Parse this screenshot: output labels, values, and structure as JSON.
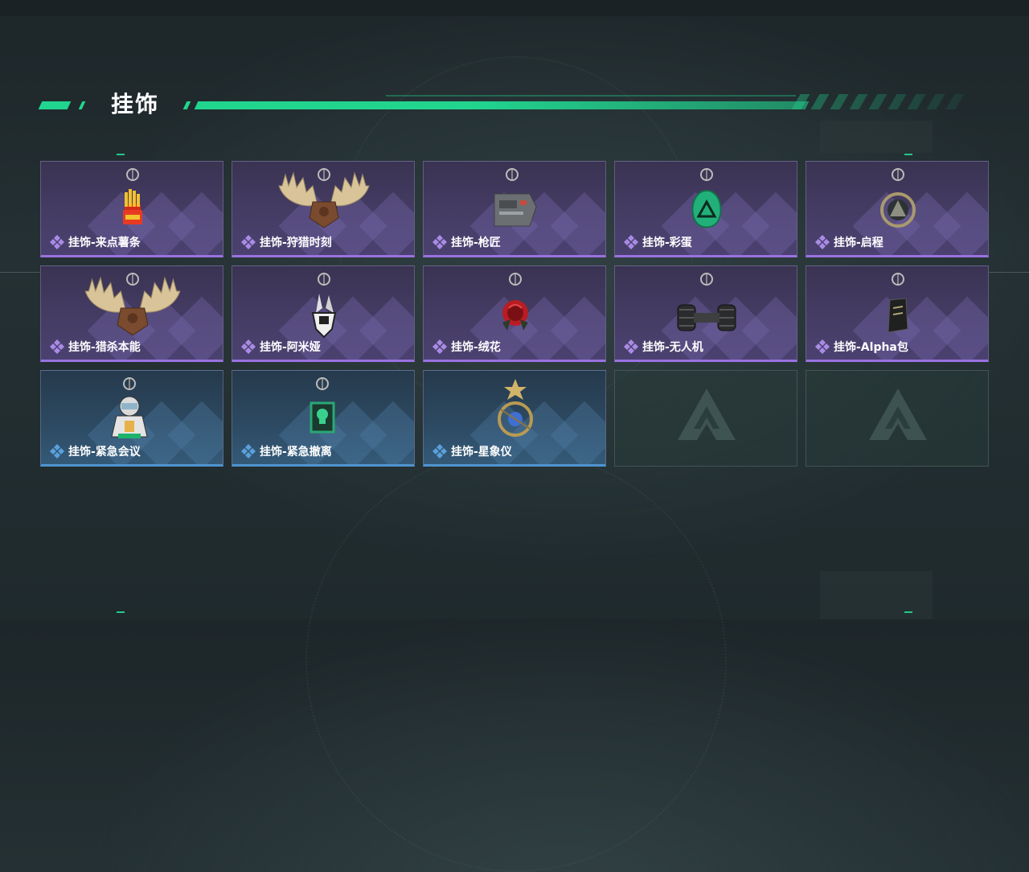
{
  "section": {
    "title": "挂饰"
  },
  "colors": {
    "accent": "#21d58f",
    "purple_rarity": "#9a72e0",
    "blue_rarity": "#4f94cf"
  },
  "items": [
    {
      "label": "挂饰-来点薯条",
      "rarity": "purple",
      "icon": "fries-charm-icon"
    },
    {
      "label": "挂饰-狩猎时刻",
      "rarity": "purple",
      "icon": "moose-antler-charm-icon"
    },
    {
      "label": "挂饰-枪匠",
      "rarity": "purple",
      "icon": "gunsmith-charm-icon"
    },
    {
      "label": "挂饰-彩蛋",
      "rarity": "purple",
      "icon": "easter-egg-charm-icon"
    },
    {
      "label": "挂饰-启程",
      "rarity": "purple",
      "icon": "compass-charm-icon"
    },
    {
      "label": "挂饰-猎杀本能",
      "rarity": "purple",
      "icon": "moose-trophy-charm-icon"
    },
    {
      "label": "挂饰-阿米娅",
      "rarity": "purple",
      "icon": "rabbit-charm-icon"
    },
    {
      "label": "挂饰-绒花",
      "rarity": "purple",
      "icon": "rose-charm-icon"
    },
    {
      "label": "挂饰-无人机",
      "rarity": "purple",
      "icon": "drone-charm-icon"
    },
    {
      "label": "挂饰-Alpha包",
      "rarity": "purple",
      "icon": "alpha-pack-charm-icon"
    },
    {
      "label": "挂饰-紧急会议",
      "rarity": "blue",
      "icon": "astronaut-charm-icon"
    },
    {
      "label": "挂饰-紧急撤离",
      "rarity": "blue",
      "icon": "skull-box-charm-icon"
    },
    {
      "label": "挂饰-星象仪",
      "rarity": "blue",
      "icon": "astrolabe-charm-icon"
    },
    {
      "label": "",
      "rarity": "empty",
      "icon": "empty-slot-logo-icon"
    },
    {
      "label": "",
      "rarity": "empty",
      "icon": "empty-slot-logo-icon"
    }
  ]
}
